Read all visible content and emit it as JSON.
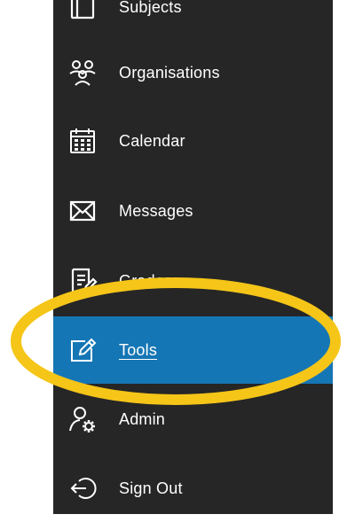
{
  "sidebar": {
    "items": [
      {
        "label": "Subjects",
        "icon": "subjects-icon",
        "active": false
      },
      {
        "label": "Organisations",
        "icon": "organisations-icon",
        "active": false
      },
      {
        "label": "Calendar",
        "icon": "calendar-icon",
        "active": false
      },
      {
        "label": "Messages",
        "icon": "messages-icon",
        "active": false
      },
      {
        "label": "Grades",
        "icon": "grades-icon",
        "active": false
      },
      {
        "label": "Tools",
        "icon": "tools-icon",
        "active": true
      },
      {
        "label": "Admin",
        "icon": "admin-icon",
        "active": false
      },
      {
        "label": "Sign Out",
        "icon": "sign-out-icon",
        "active": false
      }
    ]
  },
  "colors": {
    "sidebar_background": "#262626",
    "active_item": "#1576b5",
    "text": "#ffffff",
    "highlight_annotation": "#f5c518"
  }
}
